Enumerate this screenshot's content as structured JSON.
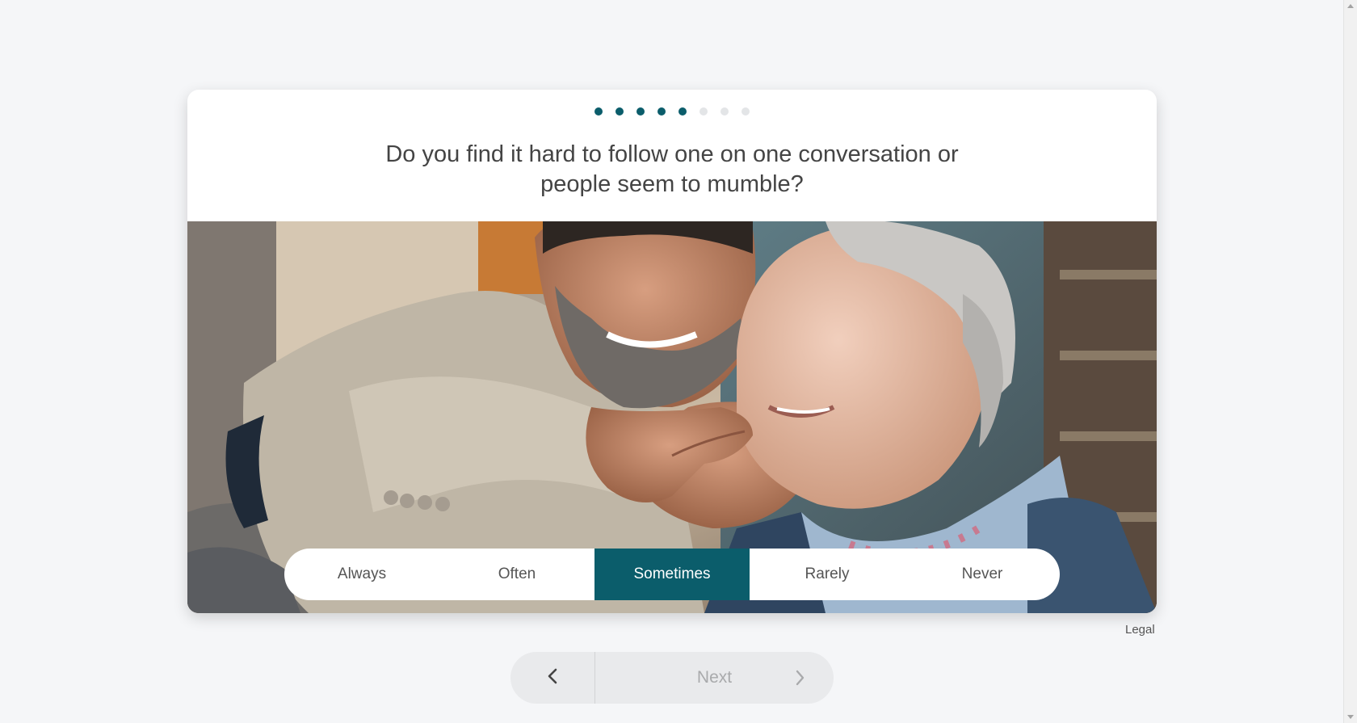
{
  "progress": {
    "total_steps": 8,
    "completed_steps": 5
  },
  "question": {
    "text": "Do you find it hard to follow one on one conversation or people seem to mumble?"
  },
  "answers": [
    {
      "label": "Always",
      "selected": false
    },
    {
      "label": "Often",
      "selected": false
    },
    {
      "label": "Sometimes",
      "selected": true
    },
    {
      "label": "Rarely",
      "selected": false
    },
    {
      "label": "Never",
      "selected": false
    }
  ],
  "footer": {
    "legal_label": "Legal"
  },
  "navigation": {
    "back_icon": "chevron-left-icon",
    "next_label": "Next",
    "next_icon": "chevron-right-icon",
    "next_enabled": false
  },
  "colors": {
    "accent": "#0b5d6b",
    "inactive_dot": "#e3e5e7",
    "background": "#f5f6f8"
  }
}
